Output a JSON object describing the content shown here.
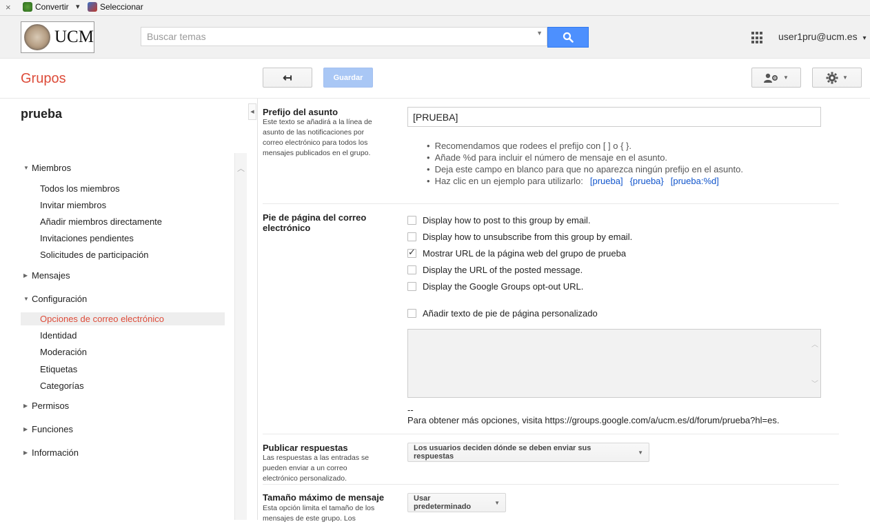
{
  "toolbar": {
    "close": "×",
    "convert": "Convertir",
    "convert_caret": "▾",
    "select": "Seleccionar"
  },
  "header": {
    "logo_text": "UCM",
    "search_placeholder": "Buscar temas",
    "search_value": "",
    "user": "user1pru@ucm.es",
    "user_caret": "▾"
  },
  "titlebar": {
    "app_title": "Grupos",
    "back_icon": "↤",
    "save_label": "Guardar",
    "members_icon": "person-gear-icon",
    "settings_icon": "gear-icon"
  },
  "sidebar": {
    "group_name": "prueba",
    "sections": {
      "miembros": {
        "label": "Miembros",
        "items": [
          "Todos los miembros",
          "Invitar miembros",
          "Añadir miembros directamente",
          "Invitaciones pendientes",
          "Solicitudes de participación"
        ]
      },
      "mensajes": {
        "label": "Mensajes"
      },
      "configuracion": {
        "label": "Configuración",
        "items": [
          "Opciones de correo electrónico",
          "Identidad",
          "Moderación",
          "Etiquetas",
          "Categorías"
        ],
        "selected": "Opciones de correo electrónico"
      },
      "permisos": {
        "label": "Permisos"
      },
      "funciones": {
        "label": "Funciones"
      },
      "informacion": {
        "label": "Información"
      }
    }
  },
  "main": {
    "prefix": {
      "label": "Prefijo del asunto",
      "description": "Este texto se añadirá a la línea de asunto de las notificaciones por correo electrónico para todos los mensajes publicados en el grupo.",
      "value": "[PRUEBA]",
      "tips": [
        "Recomendamos que rodees el prefijo con [ ] o { }.",
        "Añade %d para incluir el número de mensaje en el asunto.",
        "Deja este campo en blanco para que no aparezca ningún prefijo en el asunto.",
        "Haz clic en un ejemplo para utilizarlo:"
      ],
      "examples": [
        "[prueba]",
        "{prueba}",
        "[prueba:%d]"
      ]
    },
    "footer": {
      "label": "Pie de página del correo electrónico",
      "options": [
        {
          "label": "Display how to post to this group by email.",
          "checked": false
        },
        {
          "label": "Display how to unsubscribe from this group by email.",
          "checked": false
        },
        {
          "label": "Mostrar URL de la página web del grupo de prueba",
          "checked": true
        },
        {
          "label": "Display the URL of the posted message.",
          "checked": false
        },
        {
          "label": "Display the Google Groups opt-out URL.",
          "checked": false
        }
      ],
      "custom_label": "Añadir texto de pie de página personalizado",
      "custom_checked": false,
      "custom_text": "",
      "dashes": "--",
      "more_options": "Para obtener más opciones, visita https://groups.google.com/a/ucm.es/d/forum/prueba?hl=es."
    },
    "replies": {
      "label": "Publicar respuestas",
      "description": "Las respuestas a las entradas se pueden enviar a un correo electrónico personalizado.",
      "selected": "Los usuarios deciden dónde se deben enviar sus respuestas"
    },
    "max_size": {
      "label": "Tamaño máximo de mensaje",
      "description": "Esta opción limita el tamaño de los mensajes de este grupo. Los",
      "selected": "Usar predeterminado"
    }
  },
  "colors": {
    "brand_red": "#dd4b39",
    "search_blue": "#4d90fe",
    "link_blue": "#1155cc"
  }
}
